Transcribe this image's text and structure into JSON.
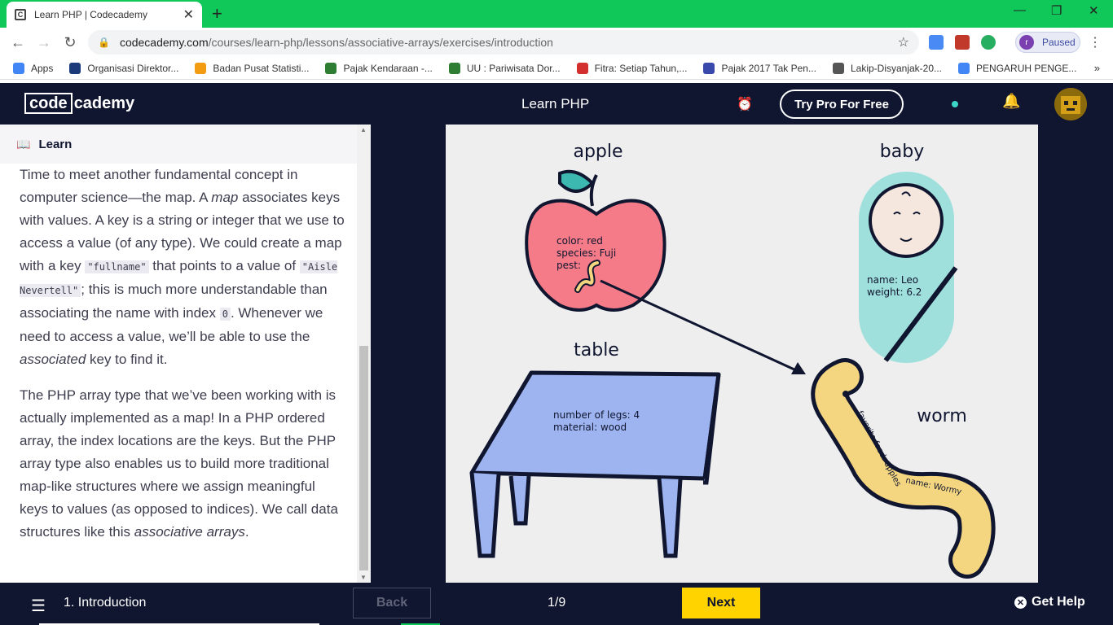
{
  "browser": {
    "tab_title": "Learn PHP | Codecademy",
    "url_domain": "codecademy.com",
    "url_path": "/courses/learn-php/lessons/associative-arrays/exercises/introduction",
    "profile_initial": "r",
    "profile_status": "Paused",
    "bookmarks": [
      {
        "label": "Apps",
        "color": "#4285f4"
      },
      {
        "label": "Organisasi Direktor...",
        "color": "#1a3a7a"
      },
      {
        "label": "Badan Pusat Statisti...",
        "color": "#f39c12"
      },
      {
        "label": "Pajak Kendaraan -...",
        "color": "#2e7d32"
      },
      {
        "label": "UU : Pariwisata Dor...",
        "color": "#2e7d32"
      },
      {
        "label": "Fitra: Setiap Tahun,...",
        "color": "#d32f2f"
      },
      {
        "label": "Pajak 2017 Tak Pen...",
        "color": "#3949ab"
      },
      {
        "label": "Lakip-Disyanjak-20...",
        "color": "#555555"
      },
      {
        "label": "PENGARUH PENGE...",
        "color": "#4285f4"
      }
    ]
  },
  "header": {
    "logo_box": "code",
    "logo_rest": "cademy",
    "course_title": "Learn PHP",
    "try_pro": "Try Pro For Free"
  },
  "learn": {
    "label": "Learn",
    "p1": {
      "a": "Time to meet another fundamental concept in computer science—the map. A ",
      "b": "map",
      "c": " associates keys with values. A key is a string or integer that we use to access a value (of any type). We could create a map with a key ",
      "d": "\"fullname\"",
      "e": " that points to a value of ",
      "f": "\"Aisle Nevertell\"",
      "g": "; this is much more understandable than associating the name with index ",
      "h": "0",
      "i": ". Whenever we need to access a value, we’ll be able to use the ",
      "j": "associated",
      "k": " key to find it."
    },
    "p2": {
      "a": "The PHP array type that we’ve been working with is actually implemented as a map! In a PHP ordered array, the index locations are the keys. But the PHP array type also enables us to build more traditional map-like structures where we assign meaningful keys to values (as opposed to indices). We call data structures like this ",
      "b": "associative arrays",
      "c": "."
    }
  },
  "diagram": {
    "apple_title": "apple",
    "apple_props": [
      "color: red",
      "species: Fuji",
      "pest:"
    ],
    "baby_title": "baby",
    "baby_props": [
      "name: Leo",
      "weight: 6.2"
    ],
    "table_title": "table",
    "table_props": [
      "number of legs: 4",
      "material: wood"
    ],
    "worm_title": "worm",
    "worm_food": "favorite food: apples",
    "worm_name": "name: Wormy"
  },
  "footer": {
    "lesson": "1. Introduction",
    "back": "Back",
    "progress": "1/9",
    "next": "Next",
    "help": "Get Help"
  }
}
